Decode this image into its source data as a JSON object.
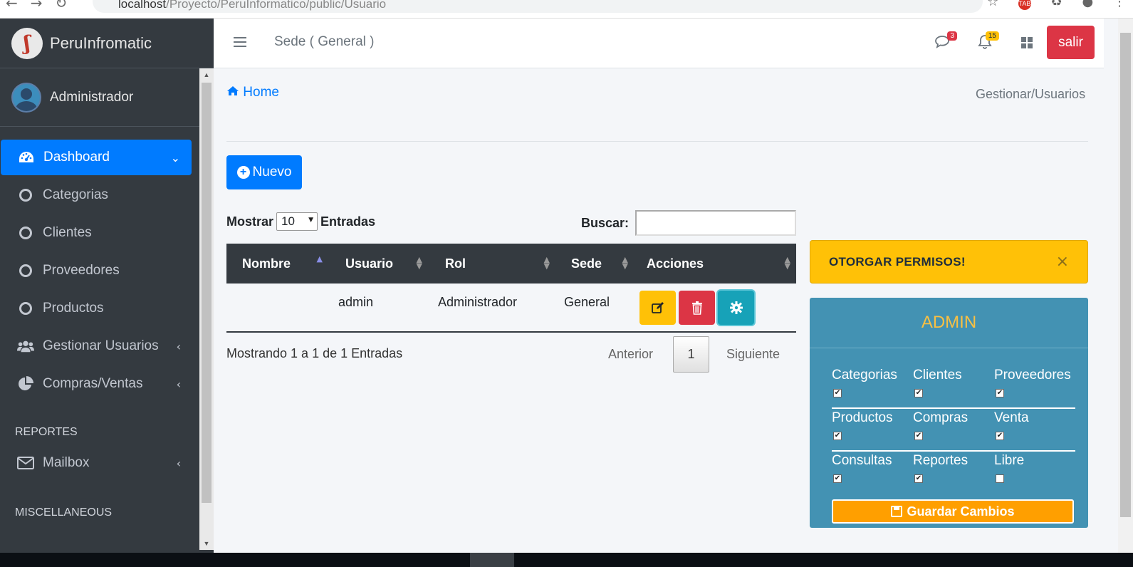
{
  "browser": {
    "url_host": "localhost",
    "url_path": "/Proyecto/PeruInformatico/public/Usuario",
    "tab_badge": "TAB"
  },
  "sidebar": {
    "brand": "PeruInfromatic",
    "user": "Administrador",
    "items": [
      {
        "label": "Dashboard",
        "icon": "tachometer-icon",
        "active": true
      },
      {
        "label": "Categorias",
        "icon": "circle-icon"
      },
      {
        "label": "Clientes",
        "icon": "circle-icon"
      },
      {
        "label": "Proveedores",
        "icon": "circle-icon"
      },
      {
        "label": "Productos",
        "icon": "circle-icon"
      },
      {
        "label": "Gestionar Usuarios",
        "icon": "users-icon"
      },
      {
        "label": "Compras/Ventas",
        "icon": "pie-chart-icon"
      }
    ],
    "header_reportes": "REPORTES",
    "mailbox": "Mailbox",
    "header_misc": "MISCELLANEOUS"
  },
  "topnav": {
    "sede": "Sede ( General )",
    "messages_count": "3",
    "notifications_count": "15",
    "logout": "salir"
  },
  "breadcrumb": {
    "home": "Home",
    "current": "Gestionar/Usuarios"
  },
  "toolbar": {
    "new_label": "Nuevo"
  },
  "datatable": {
    "show_label": "Mostrar",
    "page_size": "10",
    "entries_label": "Entradas",
    "search_label": "Buscar:",
    "search_value": "",
    "columns": [
      "Nombre",
      "Usuario",
      "Rol",
      "Sede",
      "Acciones"
    ],
    "rows": [
      {
        "nombre": "",
        "usuario": "admin",
        "rol": "Administrador",
        "sede": "General"
      }
    ],
    "info": "Mostrando 1 a 1 de 1 Entradas",
    "prev": "Anterior",
    "page": "1",
    "next": "Siguiente"
  },
  "alert": {
    "text": "OTORGAR PERMISOS!",
    "close": "×"
  },
  "permissions": {
    "title": "ADMIN",
    "items": [
      {
        "label": "Categorias",
        "checked": true
      },
      {
        "label": "Clientes",
        "checked": true
      },
      {
        "label": "Proveedores",
        "checked": true
      },
      {
        "label": "Productos",
        "checked": true
      },
      {
        "label": "Compras",
        "checked": true
      },
      {
        "label": "Venta",
        "checked": true
      },
      {
        "label": "Consultas",
        "checked": true
      },
      {
        "label": "Reportes",
        "checked": true
      },
      {
        "label": "Libre",
        "checked": false
      }
    ],
    "save_label": "Guardar Cambios"
  },
  "colors": {
    "primary": "#007bff",
    "sidebar": "#343a40",
    "danger": "#dc3545",
    "warning": "#ffc107",
    "info": "#17a2b8",
    "card": "#4392b3"
  }
}
